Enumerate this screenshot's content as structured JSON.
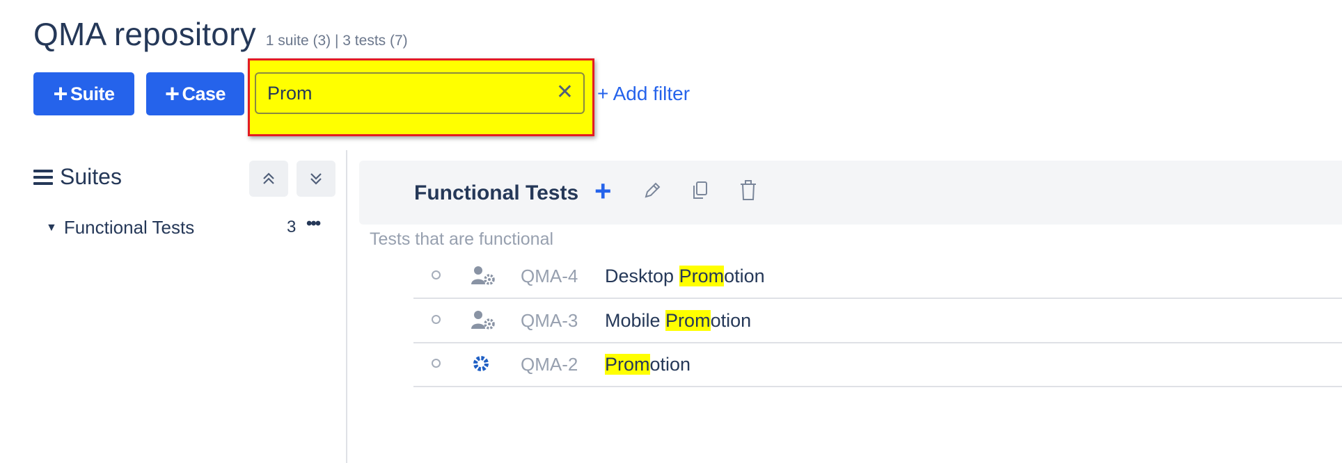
{
  "header": {
    "title": "QMA repository",
    "summary": "1 suite (3) | 3 tests (7)"
  },
  "toolbar": {
    "suite_button": "Suite",
    "case_button": "Case",
    "plus_glyph": "+",
    "search": {
      "value": "Prom",
      "clear_glyph": "✕"
    },
    "add_filter": "+ Add filter"
  },
  "sidebar": {
    "title": "Suites",
    "collapse_icon": "chevrons-up-icon",
    "expand_icon": "chevrons-down-icon",
    "items": [
      {
        "label": "Functional Tests",
        "count": "3",
        "more": "•••"
      }
    ]
  },
  "suite": {
    "name": "Functional Tests",
    "add_glyph": "+",
    "description": "Tests that are functional",
    "actions": [
      "edit-icon",
      "copy-icon",
      "delete-icon"
    ]
  },
  "cases": [
    {
      "key": "QMA-4",
      "prefix": "Desktop ",
      "match": "Prom",
      "suffix": "otion",
      "type_icon": "user-gear-icon"
    },
    {
      "key": "QMA-3",
      "prefix": "Mobile ",
      "match": "Prom",
      "suffix": "otion",
      "type_icon": "user-gear-icon"
    },
    {
      "key": "QMA-2",
      "prefix": "",
      "match": "Prom",
      "suffix": "otion",
      "type_icon": "gear-icon"
    }
  ],
  "colors": {
    "accent": "#2563eb",
    "highlight": "#ffff00",
    "annotation_border": "#e31b23"
  }
}
